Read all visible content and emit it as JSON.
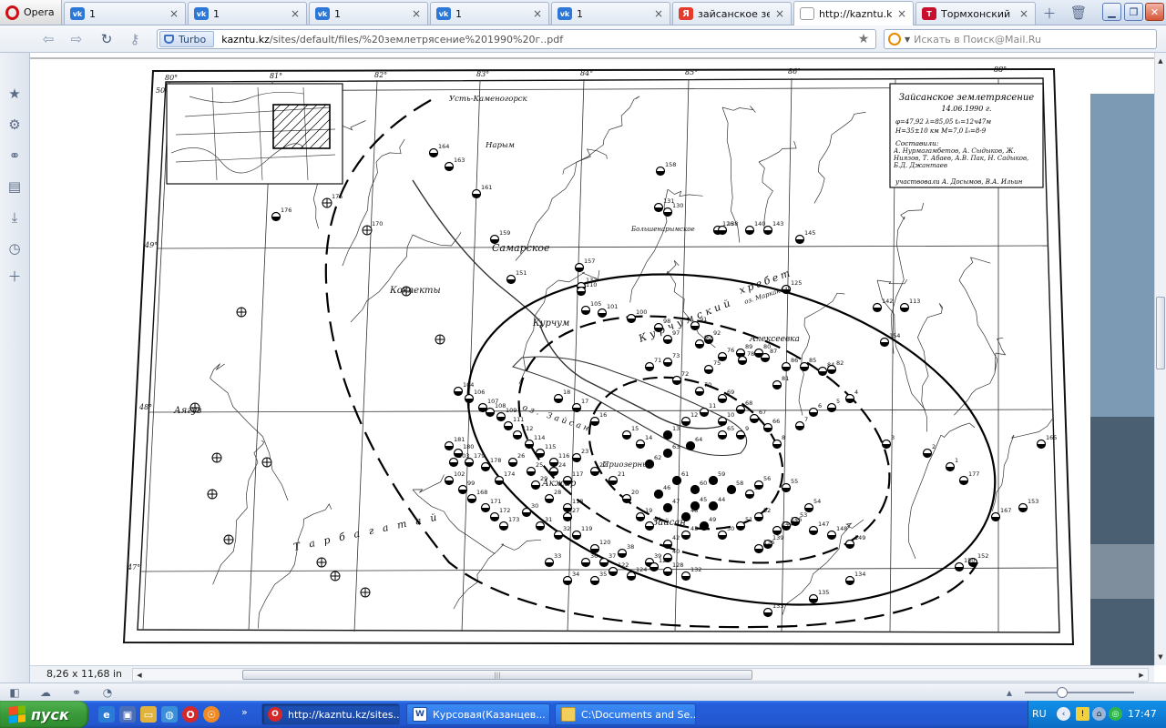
{
  "browser": {
    "menu_label": "Opera",
    "tabs": [
      {
        "title": "1",
        "icon": "vk-icon",
        "kind": "vk"
      },
      {
        "title": "1",
        "icon": "vk-icon",
        "kind": "vk"
      },
      {
        "title": "1",
        "icon": "vk-icon",
        "kind": "vk"
      },
      {
        "title": "1",
        "icon": "vk-icon",
        "kind": "vk"
      },
      {
        "title": "1",
        "icon": "vk-icon",
        "kind": "vk"
      },
      {
        "title": "зайсанское зем...",
        "icon": "yandex-icon",
        "kind": "yandex"
      },
      {
        "title": "http://kazntu.kz...",
        "icon": "kazntu-icon",
        "kind": "kazntu",
        "active": true
      },
      {
        "title": "Тормхонский вз...",
        "icon": "tmonitor-icon",
        "kind": "tmon"
      }
    ],
    "turbo_label": "Turbo",
    "url_host": "kazntu.kz",
    "url_rest": "/sites/default/files/%20землетрясение%201990%20г..pdf",
    "search_placeholder": "Искать в Поиск@Mail.Ru",
    "page_size": "8,26 x 11,68 in"
  },
  "map": {
    "inset_title": "Зайсанское землетрясение",
    "inset_date": "14.06.1990 г.",
    "params": "φ=47,92  λ=85,05  t₀=12ч47м",
    "params2": "H=35±10 км  M=7,0  I₀=8-9",
    "authors_label": "Составили:",
    "authors": "А. Нурмагамбетов, А. Сыдыков, Ж. Ниязов, Т. Абаев, А.В. Пак, Н. Садыков, Б.Д. Джантаев",
    "participants": "участвовали А. Досымов, В.А. Ильин",
    "lon_labels": [
      "80°",
      "81°",
      "82°",
      "83°",
      "84°",
      "85°",
      "86°",
      "88°"
    ],
    "lat_labels": [
      "50",
      "49°",
      "48°",
      "47°"
    ],
    "places": {
      "ust_kamenogorsk": "Усть-Каменогорск",
      "samarskoe": "Самарское",
      "kokpekty": "Кокпекты",
      "kurchum": "Курчум",
      "ayaguz": "Аягуз",
      "aktar": "Акжар",
      "zaysan": "Зайсан",
      "priozerny": "Приозерный",
      "alekseevka": "Алексеевка",
      "bolshenarymskoe": "Большенарымское",
      "narym": "Нарым",
      "markakol": "оз. Маркаколь",
      "lake_zaysan": "оз. Зайсан",
      "ridge": "хребет",
      "ridge_name": "Курчумский",
      "tarbagatay": "Тарбагатай"
    },
    "station_numbers": [
      "175",
      "176",
      "170",
      "164",
      "163",
      "161",
      "159",
      "158",
      "157",
      "151",
      "137",
      "131",
      "130",
      "126",
      "125",
      "138",
      "140",
      "143",
      "145",
      "142",
      "113",
      "154",
      "110",
      "105",
      "101",
      "100",
      "98",
      "97",
      "92",
      "91",
      "90",
      "89",
      "87",
      "86",
      "85",
      "84",
      "82",
      "81",
      "80",
      "78",
      "76",
      "75",
      "73",
      "72",
      "71",
      "70",
      "69",
      "68",
      "67",
      "66",
      "65",
      "64",
      "63",
      "62",
      "61",
      "60",
      "59",
      "58",
      "57",
      "56",
      "55",
      "54",
      "53",
      "52",
      "51",
      "50",
      "49",
      "48",
      "47",
      "46",
      "45",
      "44",
      "43",
      "42",
      "41",
      "40",
      "39",
      "38",
      "37",
      "36",
      "35",
      "34",
      "33",
      "32",
      "31",
      "30",
      "29",
      "28",
      "27",
      "26",
      "25",
      "24",
      "23",
      "22",
      "21",
      "20",
      "19",
      "18",
      "17",
      "16",
      "15",
      "14",
      "13",
      "12",
      "11",
      "10",
      "9",
      "8",
      "7",
      "6",
      "5",
      "4",
      "3",
      "2",
      "1",
      "177",
      "167",
      "165",
      "153",
      "152",
      "150",
      "149",
      "148",
      "147",
      "146",
      "144",
      "139",
      "136",
      "135",
      "134",
      "133",
      "132",
      "128",
      "127",
      "124",
      "122",
      "120",
      "119",
      "118",
      "117",
      "116",
      "115",
      "114",
      "112",
      "111",
      "109",
      "108",
      "107",
      "106",
      "104",
      "103",
      "102",
      "99",
      "168",
      "171",
      "172",
      "173",
      "174",
      "178",
      "179",
      "180",
      "181",
      "182"
    ]
  },
  "taskbar": {
    "start_label": "пуск",
    "items": [
      {
        "title": "http://kazntu.kz/sites...",
        "icon": "opera-icon",
        "active": true
      },
      {
        "title": "Курсовая(Казанцев...",
        "icon": "word-icon"
      },
      {
        "title": "C:\\Documents and Se...",
        "icon": "folder-icon"
      }
    ],
    "lang": "RU",
    "clock": "17:47"
  }
}
